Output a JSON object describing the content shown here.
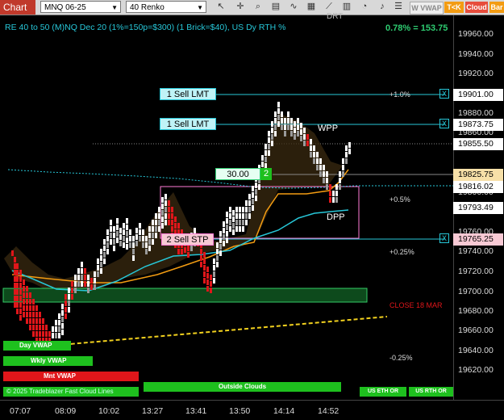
{
  "toolbar": {
    "tab": "Chart",
    "instrument": "MNQ 06-25",
    "bar_type": "40 Renko",
    "btn_wvwap": "W VWAP",
    "btn_tk": "T<K",
    "btn_cloud": "Cloud",
    "btn_bar": "Bar"
  },
  "chart": {
    "title": "RE 40 to 50 (M)NQ Dec 20 (1%=150p=$300) (1 Brick=$40), US Dy RTH %",
    "change": "0.78% = 153.75",
    "clipped_label": "DRT"
  },
  "orders": {
    "sell_lmt_1": "1 Sell LMT",
    "sell_lmt_2": "1 Sell LMT",
    "sell_stp": "2 Sell STP",
    "close_x": "X",
    "position_price": "30.00",
    "position_qty": "2"
  },
  "price_axis": {
    "labels": [
      "19960.00",
      "19940.00",
      "19920.00",
      "19880.00",
      "19860.00",
      "19800.00",
      "19780.00",
      "19760.00",
      "19740.00",
      "19720.00",
      "19700.00",
      "19680.00",
      "19660.00",
      "19640.00",
      "19620.00"
    ],
    "tags": {
      "t1": "19901.00",
      "t2": "19873.75",
      "t3": "19855.50",
      "t4": "19825.75",
      "t5": "19816.02",
      "t6": "19793.49",
      "t7": "19765.25"
    }
  },
  "time_axis": [
    "07:07",
    "08:09",
    "10:02",
    "13:27",
    "13:41",
    "13:50",
    "14:14",
    "14:52"
  ],
  "annotations": {
    "wpp": "WPP",
    "dpp": "DPP",
    "p1": "+1.0%",
    "p05": "+0.5%",
    "p025": "+0.25%",
    "m025": "-0.25%",
    "close": "CLOSE 18 MAR"
  },
  "bottom": {
    "day_vwap": "Day VWAP",
    "wkly_vwap": "Wkly VWAP",
    "mnt_vwap": "Mnt VWAP",
    "copyright": "© 2025 Tradeblazer Fast Cloud Lines",
    "outside": "Outside Clouds",
    "us_eth": "US ETH OR",
    "us_rth": "US RTH OR"
  },
  "colors": {
    "up": "#ffffff",
    "down": "#e0161a",
    "cyan": "#27c7d8",
    "orange": "#f39c12",
    "green": "#1ec01e",
    "magenta": "#ff7bd6"
  }
}
